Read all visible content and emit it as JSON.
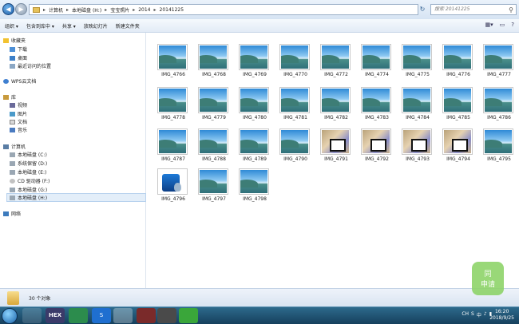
{
  "address": {
    "crumbs": [
      "计算机",
      "本地磁盘 (H:)",
      "宝宝照片",
      "2014",
      "20141225"
    ],
    "search_placeholder": "搜索 20141225"
  },
  "toolbar": {
    "items": [
      "组织 ▾",
      "包含到库中 ▾",
      "共享 ▾",
      "放映幻灯片",
      "新建文件夹"
    ]
  },
  "nav": {
    "favorites_label": "收藏夹",
    "favorites": [
      "下载",
      "桌面",
      "最近访问的位置"
    ],
    "wps": "WPS云文档",
    "libraries_label": "库",
    "libraries": [
      "视频",
      "图片",
      "文档",
      "音乐"
    ],
    "computer_label": "计算机",
    "drives": [
      "本地磁盘 (C:)",
      "系统保留 (D:)",
      "本地磁盘 (E:)",
      "CD 驱动器 (F:)",
      "本地磁盘 (G:)",
      "本地磁盘 (H:)"
    ],
    "network": "网络"
  },
  "files": [
    {
      "name": "IMG_4766",
      "kind": "landscape"
    },
    {
      "name": "IMG_4768",
      "kind": "landscape"
    },
    {
      "name": "IMG_4769",
      "kind": "landscape"
    },
    {
      "name": "IMG_4770",
      "kind": "landscape"
    },
    {
      "name": "IMG_4772",
      "kind": "landscape"
    },
    {
      "name": "IMG_4774",
      "kind": "landscape"
    },
    {
      "name": "IMG_4775",
      "kind": "landscape"
    },
    {
      "name": "IMG_4776",
      "kind": "landscape"
    },
    {
      "name": "IMG_4777",
      "kind": "landscape"
    },
    {
      "name": "IMG_4778",
      "kind": "landscape"
    },
    {
      "name": "IMG_4779",
      "kind": "landscape"
    },
    {
      "name": "IMG_4780",
      "kind": "landscape"
    },
    {
      "name": "IMG_4781",
      "kind": "landscape"
    },
    {
      "name": "IMG_4782",
      "kind": "landscape"
    },
    {
      "name": "IMG_4783",
      "kind": "landscape"
    },
    {
      "name": "IMG_4784",
      "kind": "landscape"
    },
    {
      "name": "IMG_4785",
      "kind": "landscape"
    },
    {
      "name": "IMG_4786",
      "kind": "landscape"
    },
    {
      "name": "IMG_4787",
      "kind": "landscape"
    },
    {
      "name": "IMG_4788",
      "kind": "landscape"
    },
    {
      "name": "IMG_4789",
      "kind": "landscape"
    },
    {
      "name": "IMG_4790",
      "kind": "landscape"
    },
    {
      "name": "IMG_4791",
      "kind": "photo"
    },
    {
      "name": "IMG_4792",
      "kind": "photo"
    },
    {
      "name": "IMG_4793",
      "kind": "photo"
    },
    {
      "name": "IMG_4794",
      "kind": "photo"
    },
    {
      "name": "IMG_4795",
      "kind": "landscape"
    },
    {
      "name": "IMG_4796",
      "kind": "media"
    },
    {
      "name": "IMG_4797",
      "kind": "landscape"
    },
    {
      "name": "IMG_4798",
      "kind": "landscape"
    }
  ],
  "status": {
    "count_text": "30 个对象"
  },
  "watermark": "同\n申请",
  "taskbar": {
    "apps": [
      "",
      "",
      "HEX",
      "",
      "S",
      "",
      "",
      "",
      "",
      ""
    ],
    "tray": [
      "CH",
      "S",
      "中"
    ],
    "time": "16:20",
    "date": "2018/9/25"
  },
  "colors": {
    "accent": "#1d5fa9",
    "taskbar": "#16405d"
  }
}
